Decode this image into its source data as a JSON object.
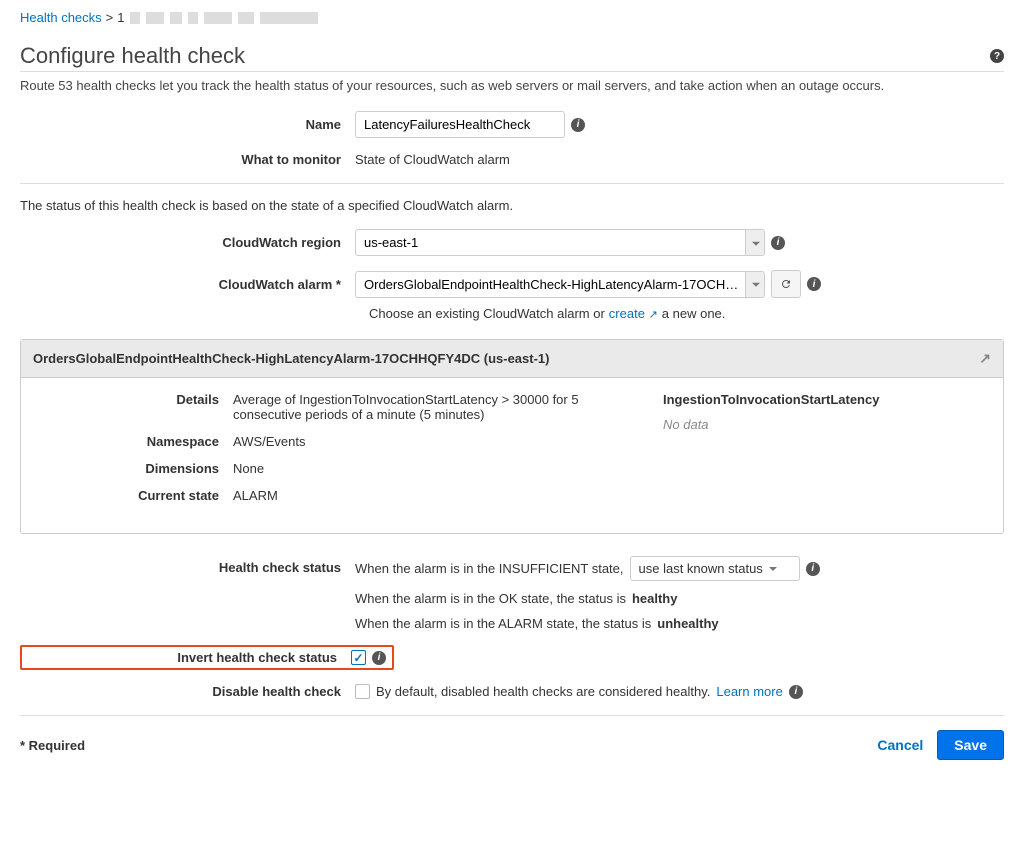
{
  "breadcrumb": {
    "root": "Health checks",
    "separator": ">",
    "id_prefix": "1"
  },
  "page": {
    "title": "Configure health check",
    "intro": "Route 53 health checks let you track the health status of your resources, such as web servers or mail servers, and take action when an outage occurs."
  },
  "form": {
    "name_label": "Name",
    "name_value": "LatencyFailuresHealthCheck",
    "monitor_label": "What to monitor",
    "monitor_value": "State of CloudWatch alarm"
  },
  "cloudwatch": {
    "intro": "The status of this health check is based on the state of a specified CloudWatch alarm.",
    "region_label": "CloudWatch region",
    "region_value": "us-east-1",
    "alarm_label": "CloudWatch alarm *",
    "alarm_value": "OrdersGlobalEndpointHealthCheck-HighLatencyAlarm-17OCH…",
    "helper_pre": "Choose an existing CloudWatch alarm or",
    "helper_link": "create",
    "helper_post": "a new one."
  },
  "alarm_card": {
    "title": "OrdersGlobalEndpointHealthCheck-HighLatencyAlarm-17OCHHQFY4DC (us-east-1)",
    "details_label": "Details",
    "details_value": "Average of IngestionToInvocationStartLatency > 30000 for 5 consecutive periods of a minute (5 minutes)",
    "namespace_label": "Namespace",
    "namespace_value": "AWS/Events",
    "dimensions_label": "Dimensions",
    "dimensions_value": "None",
    "state_label": "Current state",
    "state_value": "ALARM",
    "metric_name": "IngestionToInvocationStartLatency",
    "nodata": "No data"
  },
  "status": {
    "label": "Health check status",
    "line1_pre": "When the alarm is in the INSUFFICIENT state,",
    "line1_select": "use last known status",
    "line2_pre": "When the alarm is in the OK state, the status is ",
    "line2_bold": "healthy",
    "line3_pre": "When the alarm is in the ALARM state, the status is ",
    "line3_bold": "unhealthy"
  },
  "invert": {
    "label": "Invert health check status"
  },
  "disable": {
    "label": "Disable health check",
    "text_pre": "By default, disabled health checks are considered healthy.",
    "learn_more": "Learn more"
  },
  "footer": {
    "required": "* Required",
    "cancel": "Cancel",
    "save": "Save"
  }
}
